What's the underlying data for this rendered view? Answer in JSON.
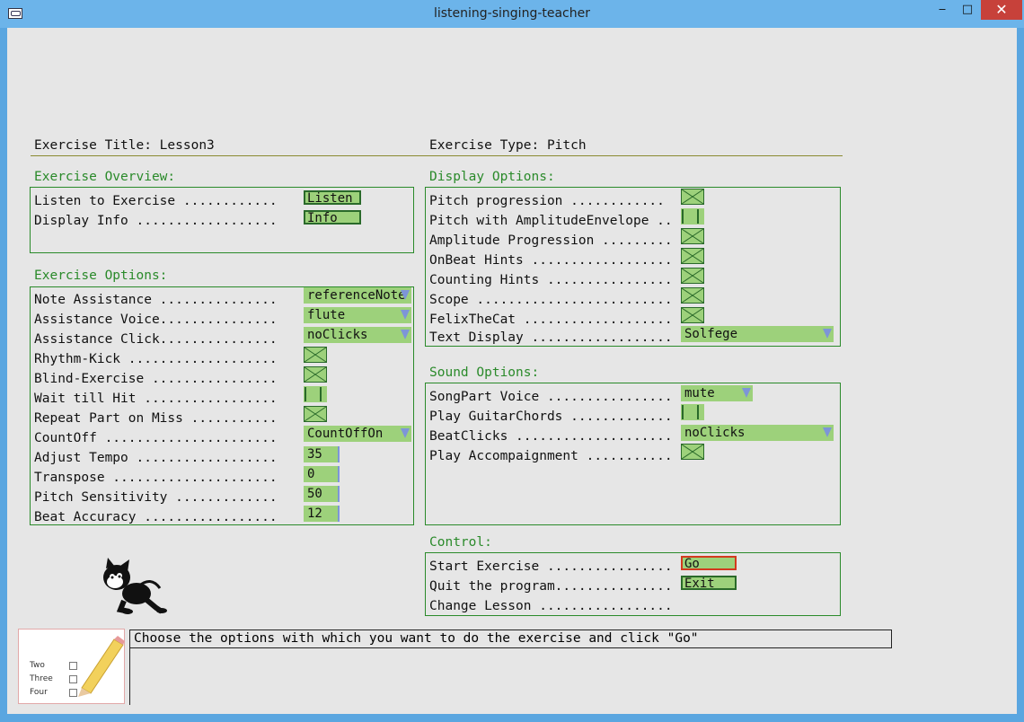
{
  "window": {
    "title": "listening-singing-teacher",
    "min_icon": "minimize-icon",
    "max_icon": "maximize-icon",
    "close_icon": "close-icon",
    "min_glyph": "‒",
    "max_glyph": "□",
    "close_glyph": "✕"
  },
  "header": {
    "exercise_title": "Exercise Title: Lesson3",
    "exercise_type": "Exercise Type: Pitch"
  },
  "overview": {
    "heading": "Exercise Overview:",
    "rows": [
      {
        "label": "Listen to Exercise ............",
        "button": "Listen"
      },
      {
        "label": "Display Info ..................",
        "button": "Info"
      }
    ]
  },
  "exercise_options": {
    "heading": "Exercise Options:",
    "labels": [
      "Note Assistance ...............",
      "Assistance Voice...............",
      "Assistance Click...............",
      "Rhythm-Kick ...................",
      "Blind-Exercise ................",
      "Wait till Hit .................",
      "Repeat Part on Miss ...........",
      "CountOff ......................",
      "Adjust Tempo ..................",
      "Transpose .....................",
      "Pitch Sensitivity .............",
      "Beat Accuracy ................."
    ],
    "note_assistance": "referenceNote",
    "assistance_voice": "flute",
    "assistance_click": "noClicks",
    "rhythm_kick": true,
    "blind_exercise": true,
    "wait_till_hit": false,
    "repeat_part_on_miss": true,
    "countoff": "CountOffOn",
    "adjust_tempo": "35",
    "transpose": "0",
    "pitch_sensitivity": "50",
    "beat_accuracy": "12"
  },
  "display_options": {
    "heading": "Display Options:",
    "labels": [
      "Pitch progression ............",
      "Pitch with AmplitudeEnvelope ..",
      "Amplitude Progression .........",
      "OnBeat Hints ..................",
      "Counting Hints ................",
      "Scope .........................",
      "FelixTheCat ...................",
      "Text Display .................."
    ],
    "pitch_progression": true,
    "pitch_with_amplitude_envelope": false,
    "amplitude_progression": true,
    "onbeat_hints": true,
    "counting_hints": true,
    "scope": true,
    "felix_the_cat": true,
    "text_display": "Solfege"
  },
  "sound_options": {
    "heading": "Sound Options:",
    "labels": [
      "SongPart Voice ................",
      "Play GuitarChords .............",
      "BeatClicks ....................",
      "Play Accompaignment ..........."
    ],
    "songpart_voice": "mute",
    "play_guitar_chords": false,
    "beat_clicks": "noClicks",
    "play_accompaniment": true
  },
  "control": {
    "heading": "Control:",
    "labels": [
      "Start Exercise ................",
      "Quit the program...............",
      "Change Lesson ................."
    ],
    "go": "Go",
    "exit": "Exit"
  },
  "status": {
    "message": "Choose the options with which you want to do the exercise and click \"Go\""
  },
  "thumbnail": {
    "items": [
      "Two",
      "Three",
      "Four"
    ]
  },
  "colors": {
    "control_green": "#9dd17b",
    "heading_green": "#2a8a2a",
    "arrow_blue": "#7d95d8"
  }
}
